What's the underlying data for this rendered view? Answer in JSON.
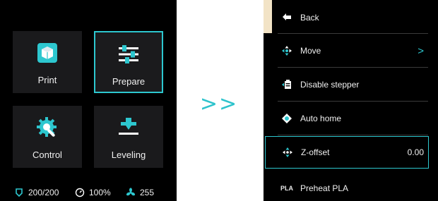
{
  "left_screen": {
    "tiles": [
      {
        "label": "Print"
      },
      {
        "label": "Prepare"
      },
      {
        "label": "Control"
      },
      {
        "label": "Leveling"
      }
    ],
    "status": {
      "temperature": "200/200",
      "speed": "100%",
      "fan": "255"
    }
  },
  "transition_label": ">>",
  "right_screen": {
    "menu": [
      {
        "label": "Back",
        "icon": "back-arrow-icon"
      },
      {
        "label": "Move",
        "icon": "move-icon",
        "chevron": ">"
      },
      {
        "label": "Disable stepper",
        "icon": "disable-stepper-icon"
      },
      {
        "label": "Auto home",
        "icon": "home-target-icon"
      },
      {
        "label": "Z-offset",
        "icon": "z-offset-icon",
        "value": "0.00"
      },
      {
        "label": "Preheat PLA",
        "icon_text": "PLA"
      }
    ]
  },
  "colors": {
    "accent": "#2dc7cf",
    "screen_bg": "#000000",
    "tile_bg": "#1a1a1c",
    "tab_marker": "#f2e3c6"
  }
}
